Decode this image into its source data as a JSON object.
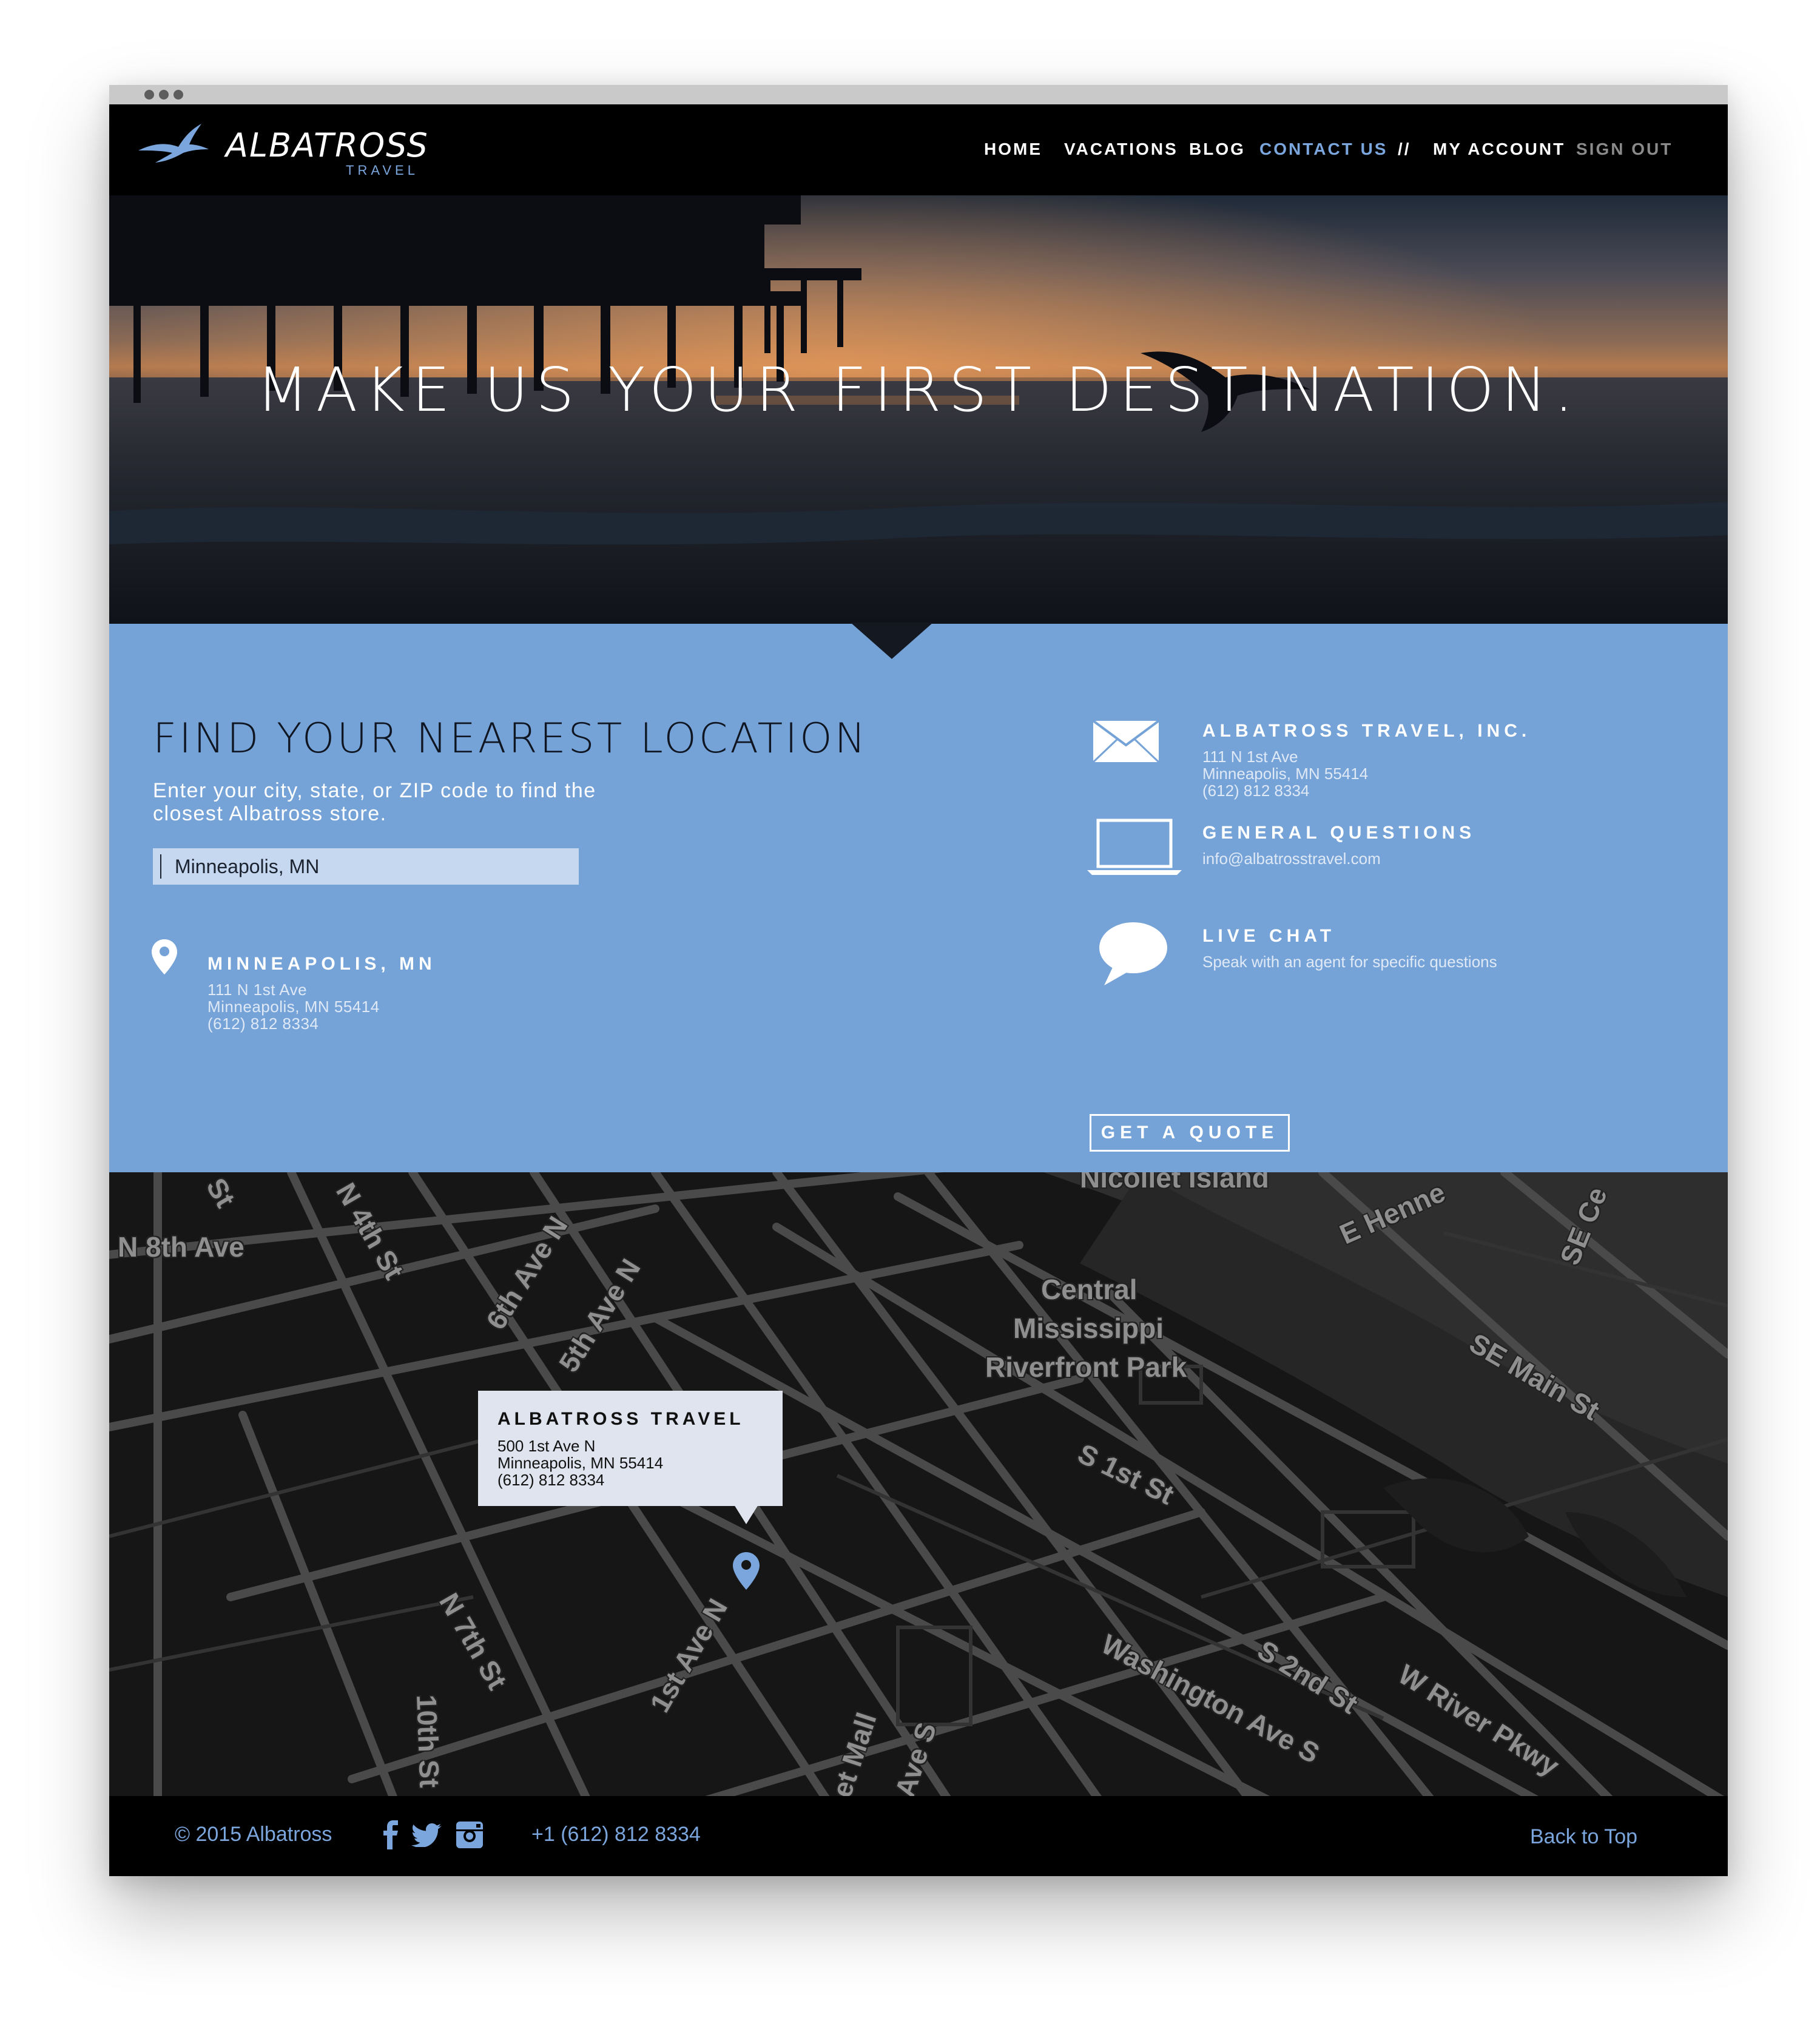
{
  "nav": {
    "brand": "ALBATROSS",
    "brand_sub": "TRAVEL",
    "items": [
      {
        "label": "HOME"
      },
      {
        "label": "VACATIONS"
      },
      {
        "label": "BLOG"
      },
      {
        "label": "CONTACT US"
      }
    ],
    "separator": "//",
    "account_items": [
      {
        "label": "MY ACCOUNT"
      },
      {
        "label": "SIGN OUT"
      }
    ],
    "active_item": "CONTACT US"
  },
  "hero": {
    "title": "MAKE US YOUR FIRST DESTINATION."
  },
  "finder": {
    "title": "FIND YOUR NEAREST LOCATION",
    "subtitle_line1": "Enter your city, state, or ZIP code to find the",
    "subtitle_line2": "closest Albatross store.",
    "search_value": "Minneapolis, MN",
    "result": {
      "title": "MINNEAPOLIS, MN",
      "address": "111 N 1st Ave",
      "city": "Minneapolis, MN 55414",
      "phone": "(612) 812 8334"
    }
  },
  "contact": {
    "company": {
      "title": "ALBATROSS TRAVEL, INC.",
      "address": "111 N 1st Ave",
      "city": "Minneapolis, MN 55414",
      "phone": "(612) 812 8334",
      "icon": "envelope-icon"
    },
    "questions": {
      "title": "GENERAL QUESTIONS",
      "email": "info@albatrosstravel.com",
      "icon": "laptop-icon"
    },
    "chat": {
      "title": "LIVE CHAT",
      "text": "Speak with an agent for specific questions",
      "icon": "chat-bubble-icon"
    },
    "quote_button": "GET A QUOTE"
  },
  "map": {
    "labels": [
      "N 8th Ave",
      "N 4th St",
      "6th Ave N",
      "5th Ave N",
      "Nicollet Island",
      "E Henne",
      "SE Ce",
      "Central",
      "Mississippi",
      "Riverfront Park",
      "SE Main St",
      "S 1st St",
      "N 7th St",
      "10th St",
      "1st Ave N",
      "Washington Ave S",
      "S 2nd St",
      "W River Pkwy",
      "et Mall",
      "Ave S",
      "St",
      "St"
    ],
    "popup": {
      "title": "ALBATROSS TRAVEL",
      "address": "500 1st Ave N",
      "city": "Minneapolis, MN 55414",
      "phone": "(612) 812 8334"
    }
  },
  "footer": {
    "copyright": "© 2015 Albatross",
    "phone": "+1 (612) 812 8334",
    "back_to_top": "Back to Top",
    "social_icons": [
      "facebook-icon",
      "twitter-icon",
      "instagram-icon"
    ]
  },
  "colors": {
    "accent": "#7aa6dd",
    "panel": "#75a3d8",
    "nav_bg": "#000000",
    "map_bg": "#161616"
  }
}
